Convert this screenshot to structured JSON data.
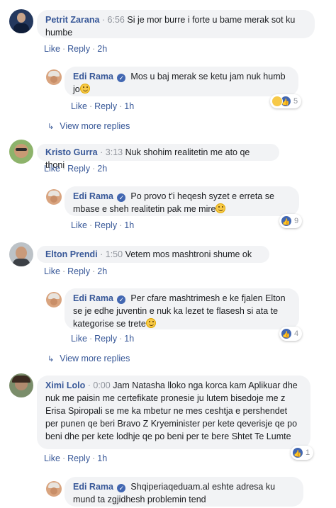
{
  "labels": {
    "like": "Like",
    "reply": "Reply",
    "view_more": "View more replies"
  },
  "comments": [
    {
      "author": "Petrit Zarana",
      "time": "6:56",
      "text": "Si je mor burre i forte u bame merak sot ku humbe",
      "age": "2h"
    },
    {
      "author": "Edi Rama",
      "text": "Mos u baj merak se ketu jam nuk humb jo",
      "age": "1h",
      "reactions": "5"
    },
    {
      "author": "Kristo Gurra",
      "time": "3:13",
      "text": "Nuk shohim realitetin me ato qe thoni",
      "age": "2h"
    },
    {
      "author": "Edi Rama",
      "text": "Po provo t'i heqesh syzet e erreta se mbase e sheh realitetin pak me mire",
      "age": "1h",
      "reactions": "9"
    },
    {
      "author": "Elton Prendi",
      "time": "1:50",
      "text": "Vetem mos mashtroni shume ok",
      "age": "2h"
    },
    {
      "author": "Edi Rama",
      "text": "Per cfare mashtrimesh e ke fjalen Elton se je edhe juventin e nuk ka lezet te flasesh si ata te kategorise se trete",
      "age": "1h",
      "reactions": "4"
    },
    {
      "author": "Ximi Lolo",
      "time": "0:00",
      "text": "Jam Natasha lloko nga korca kam Aplikuar dhe nuk me paisin me certefikate pronesie ju lutem bisedoje me z Erisa Spiropali se me ka mbetur ne mes ceshtja e pershendet per punen qe beri Bravo Z Kryeminister per kete qeverisje qe po beni dhe per kete lodhje qe po beni per te bere Shtet Te Lumte",
      "age": "1h",
      "reactions": "1"
    },
    {
      "author": "Edi Rama",
      "text": "Shqiperiaqeduam.al eshte adresa ku mund ta zgjidhesh problemin tend"
    }
  ],
  "colors": {
    "link": "#385898",
    "bubble": "#f2f3f5",
    "verified": "#4267b2",
    "meta": "#90949c"
  }
}
